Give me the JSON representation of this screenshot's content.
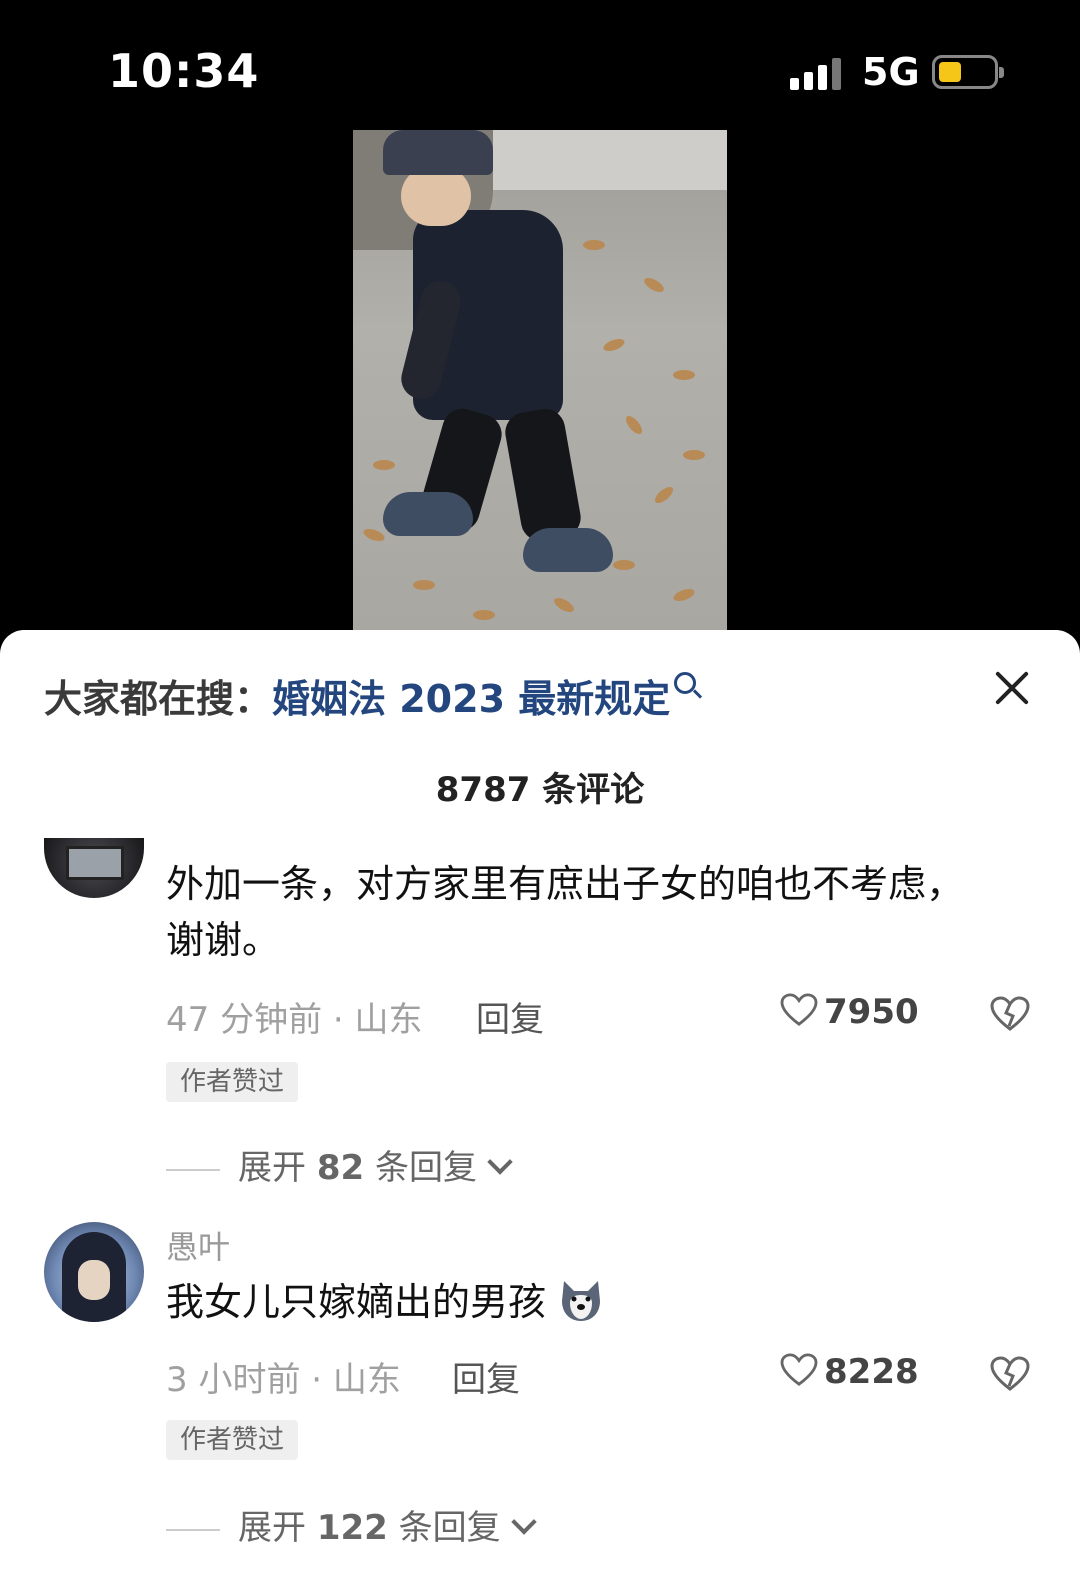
{
  "status_bar": {
    "time": "10:34",
    "network": "5G",
    "battery_level": 0.35,
    "battery_color": "#f5c518"
  },
  "video": {
    "icon": "video-thumbnail"
  },
  "search": {
    "label": "大家都在搜：",
    "term": "婚姻法 2023 最新规定",
    "term_color": "#23467f"
  },
  "comments_header": {
    "count": "8787 条评论"
  },
  "comments": [
    {
      "username": "",
      "text": "外加一条，对方家里有庶出子女的咱也不考虑，谢谢。",
      "time_location": "47 分钟前 · 山东",
      "reply": "回复",
      "likes": "7950",
      "badge": "作者赞过",
      "expand_prefix": "展开 ",
      "expand_count": "82",
      "expand_suffix": " 条回复"
    },
    {
      "username": "愚叶",
      "text": "我女儿只嫁嫡出的男孩",
      "emoji": "husky-emoji",
      "time_location": "3 小时前 · 山东",
      "reply": "回复",
      "likes": "8228",
      "badge": "作者赞过",
      "expand_prefix": "展开 ",
      "expand_count": "122",
      "expand_suffix": " 条回复"
    }
  ]
}
